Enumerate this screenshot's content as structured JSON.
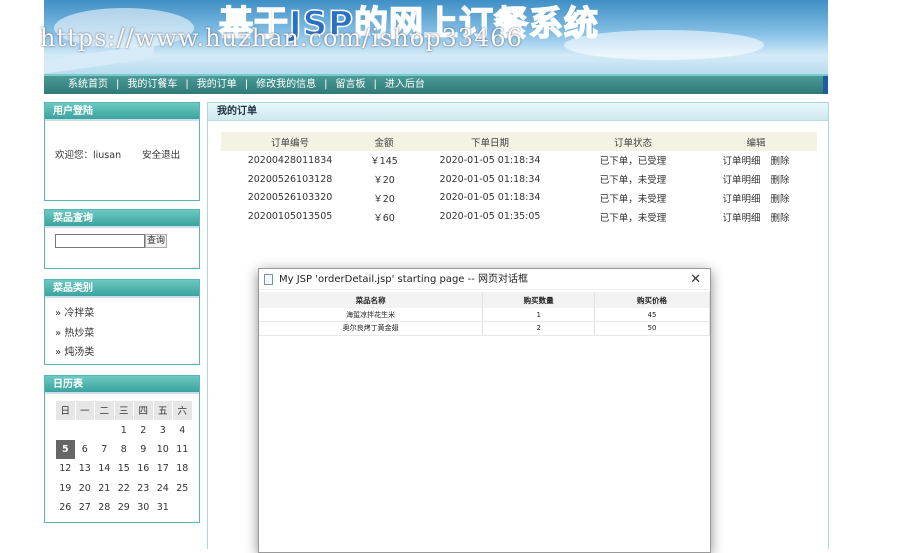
{
  "banner": {
    "title": "基于JSP的网上订餐系统"
  },
  "watermark": "https://www.huzhan.com/ishop33466",
  "nav": {
    "items": [
      "系统首页",
      "我的订餐车",
      "我的订单",
      "修改我的信息",
      "留言板",
      "进入后台"
    ],
    "separator": "|"
  },
  "login": {
    "header": "用户登陆",
    "welcome": "欢迎您：liusan",
    "logout": "安全退出"
  },
  "search": {
    "header": "菜品查询",
    "input_value": "",
    "button": "查询"
  },
  "categories": {
    "header": "菜品类别",
    "items": [
      "冷拌菜",
      "热炒菜",
      "炖汤类"
    ],
    "bullet": "»"
  },
  "calendar": {
    "header": "日历表",
    "weekdays": [
      "日",
      "一",
      "二",
      "三",
      "四",
      "五",
      "六"
    ],
    "weeks": [
      [
        "",
        "",
        "",
        "1",
        "2",
        "3",
        "4"
      ],
      [
        "5",
        "6",
        "7",
        "8",
        "9",
        "10",
        "11"
      ],
      [
        "12",
        "13",
        "14",
        "15",
        "16",
        "17",
        "18"
      ],
      [
        "19",
        "20",
        "21",
        "22",
        "23",
        "24",
        "25"
      ],
      [
        "26",
        "27",
        "28",
        "29",
        "30",
        "31",
        ""
      ]
    ],
    "today": "5"
  },
  "orders": {
    "header": "我的订单",
    "columns": [
      "订单编号",
      "金额",
      "下单日期",
      "订单状态",
      "编辑"
    ],
    "rows": [
      {
        "id": "20200428011834",
        "amount": "￥145",
        "date": "2020-01-05 01:18:34",
        "status": "已下单，已受理",
        "detail": "订单明细",
        "delete": "删除"
      },
      {
        "id": "20200526103128",
        "amount": "￥20",
        "date": "2020-01-05 01:18:34",
        "status": "已下单，未受理",
        "detail": "订单明细",
        "delete": "删除"
      },
      {
        "id": "20200526103320",
        "amount": "￥20",
        "date": "2020-01-05 01:18:34",
        "status": "已下单，未受理",
        "detail": "订单明细",
        "delete": "删除"
      },
      {
        "id": "20200105013505",
        "amount": "￥60",
        "date": "2020-01-05 01:35:05",
        "status": "已下单，未受理",
        "detail": "订单明细",
        "delete": "删除"
      }
    ]
  },
  "dialog": {
    "title": "My JSP 'orderDetail.jsp' starting page -- 网页对话框",
    "close": "✕",
    "columns": [
      "菜品名称",
      "购买数量",
      "购买价格"
    ],
    "rows": [
      [
        "海蜇凉拌花生米",
        "1",
        "45"
      ],
      [
        "奥尔良烤丁黄金翅",
        "2",
        "50"
      ]
    ]
  },
  "colors": {
    "teal": "#3aa39d",
    "nav": "#2f7a77",
    "banner_text": "#2d6fc0"
  }
}
